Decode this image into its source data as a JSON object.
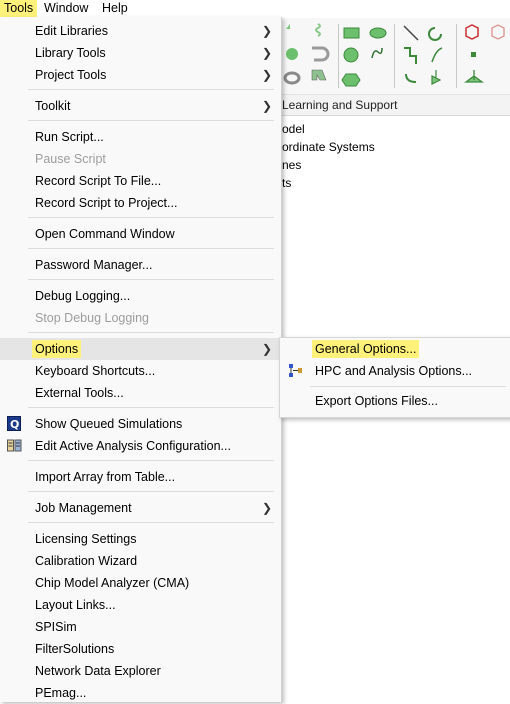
{
  "menubar": {
    "tools": "Tools",
    "window": "Window",
    "help": "Help"
  },
  "background": {
    "ribbon_tab": "Learning and Support",
    "tree": [
      "odel",
      "ordinate Systems",
      "nes",
      "ts"
    ]
  },
  "menu": {
    "items": [
      {
        "label": "Edit Libraries",
        "submenu": true
      },
      {
        "label": "Library Tools",
        "submenu": true
      },
      {
        "label": "Project Tools",
        "submenu": true
      },
      {
        "label": "Toolkit",
        "submenu": true
      },
      {
        "label": "Run Script..."
      },
      {
        "label": "Pause Script",
        "disabled": true
      },
      {
        "label": "Record Script To File..."
      },
      {
        "label": "Record Script to Project..."
      },
      {
        "label": "Open Command Window"
      },
      {
        "label": "Password Manager..."
      },
      {
        "label": "Debug Logging..."
      },
      {
        "label": "Stop Debug Logging",
        "disabled": true
      },
      {
        "label": "Options",
        "submenu": true,
        "highlighted": true
      },
      {
        "label": "Keyboard Shortcuts..."
      },
      {
        "label": "External Tools..."
      },
      {
        "label": "Show Queued Simulations"
      },
      {
        "label": "Edit Active Analysis Configuration..."
      },
      {
        "label": "Import Array from Table..."
      },
      {
        "label": "Job Management",
        "submenu": true
      },
      {
        "label": "Licensing Settings"
      },
      {
        "label": "Calibration Wizard"
      },
      {
        "label": "Chip Model Analyzer (CMA)"
      },
      {
        "label": "Layout Links..."
      },
      {
        "label": "SPISim"
      },
      {
        "label": "FilterSolutions"
      },
      {
        "label": "Network Data Explorer"
      },
      {
        "label": "PEmag..."
      }
    ]
  },
  "submenu": {
    "items": [
      {
        "label": "General Options..."
      },
      {
        "label": "HPC and Analysis Options..."
      },
      {
        "label": "Export Options Files..."
      }
    ]
  },
  "colors": {
    "highlight_yellow": "#fff17a",
    "menu_bg": "#f9f9f9",
    "hover_bg": "#e5e5e5",
    "disabled_text": "#9d9d9d"
  }
}
